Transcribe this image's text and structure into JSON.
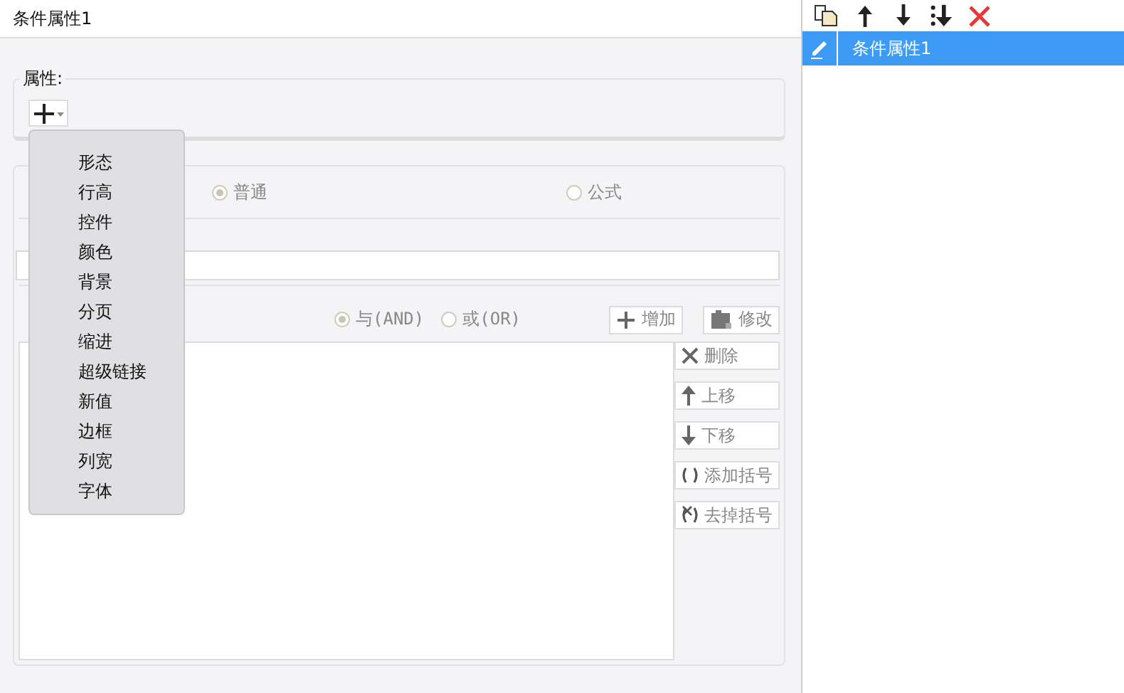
{
  "title": "条件属性1",
  "property_section": {
    "legend": "属性:",
    "menu": {
      "items": [
        "形态",
        "行高",
        "控件",
        "颜色",
        "背景",
        "分页",
        "缩进",
        "超级链接",
        "新值",
        "边框",
        "列宽",
        "字体"
      ]
    }
  },
  "condition_section": {
    "type_options": [
      {
        "label": "普通",
        "selected": true
      },
      {
        "label": "公式",
        "selected": false
      }
    ],
    "logic_options": [
      {
        "label": "与(AND)",
        "selected": true
      },
      {
        "label": "或(OR)",
        "selected": false
      }
    ],
    "top_buttons": [
      {
        "kind": "add",
        "label": "增加"
      },
      {
        "kind": "edit",
        "label": "修改"
      }
    ],
    "side_buttons": [
      {
        "kind": "delete",
        "label": "删除"
      },
      {
        "kind": "up",
        "label": "上移"
      },
      {
        "kind": "down",
        "label": "下移"
      },
      {
        "kind": "bracket",
        "label": "添加括号"
      },
      {
        "kind": "unbracket",
        "label": "去掉括号"
      }
    ]
  },
  "right_panel": {
    "toolbar": [
      {
        "kind": "copy"
      },
      {
        "kind": "up"
      },
      {
        "kind": "down"
      },
      {
        "kind": "bottom"
      },
      {
        "kind": "delete"
      }
    ],
    "items": [
      {
        "label": "条件属性1",
        "selected": true
      }
    ]
  }
}
